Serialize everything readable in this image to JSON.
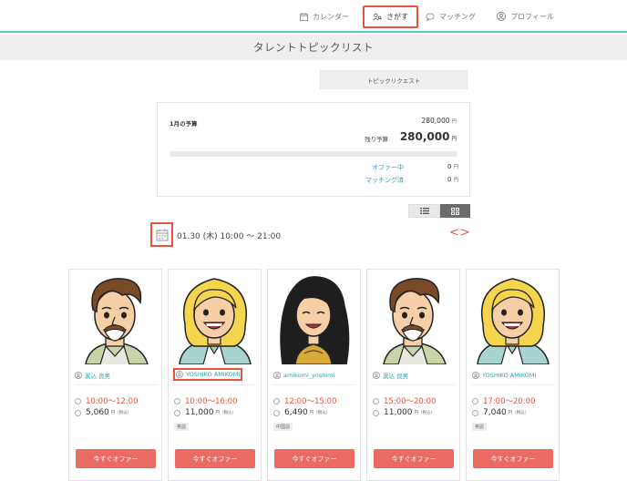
{
  "nav": {
    "calendar": "カレンダー",
    "search": "さがす",
    "matching": "マッチング",
    "profile": "プロフィール"
  },
  "page_title": "タレントトピックリスト",
  "topic_request_button": "トピックリクエスト",
  "budget": {
    "month_label": "1月の予算",
    "total": "280,000",
    "total_unit": "円",
    "remaining_label": "残り予算",
    "remaining": "280,000",
    "remaining_unit": "円",
    "offering_label": "オファー中",
    "offering_value": "0",
    "offering_unit": "円",
    "matched_label": "マッチング済",
    "matched_value": "0",
    "matched_unit": "円",
    "used_fraction": 0
  },
  "date": {
    "text": "01.30 (木) 10:00 〜 21:00",
    "arrows": "<>"
  },
  "cards": [
    {
      "name": "黒込 良男",
      "time": "10:00〜12:00",
      "price": "5,060",
      "price_unit": "円（税込）",
      "badge": ""
    },
    {
      "name": "YOSHIKO AMIKOMI",
      "time": "10:00〜16:00",
      "price": "11,000",
      "price_unit": "円（税込）",
      "badge": "英語"
    },
    {
      "name": "amikomi_yoshimi",
      "time": "12:00〜15:00",
      "price": "6,490",
      "price_unit": "円（税込）",
      "badge": "中国語"
    },
    {
      "name": "黒込 良男",
      "time": "15:00〜20:00",
      "price": "11,000",
      "price_unit": "円（税込）",
      "badge": ""
    },
    {
      "name": "YOSHIKO AMIKOMI",
      "time": "17:00〜20:00",
      "price": "7,040",
      "price_unit": "円（税込）",
      "badge": "英語"
    }
  ],
  "offer_button": "今すぐオファー",
  "colors": {
    "accent_teal": "#5cc6cc",
    "highlight_red": "#e8533c",
    "offer_red": "#ea6b62",
    "link_teal": "#2a9fb0"
  }
}
